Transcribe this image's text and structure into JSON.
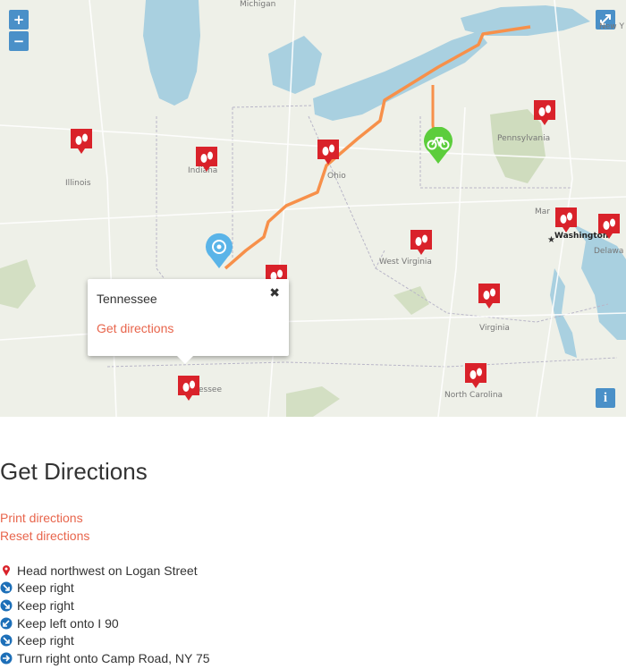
{
  "map": {
    "zoom_in": "+",
    "zoom_out": "−",
    "fullscreen_icon": "expand-icon",
    "info_icon": "i",
    "labels": {
      "michigan": "Michigan",
      "new_york": "New Y",
      "pennsylvania": "Pennsylvania",
      "illinois": "Illinois",
      "indiana": "Indiana",
      "ohio": "Ohio",
      "maryland": "Mar",
      "washington": "Washington",
      "delaware": "Delawa",
      "west_virginia": "West Virginia",
      "virginia": "Virginia",
      "tennessee": "essee",
      "north_carolina": "North Carolina"
    },
    "colors": {
      "route": "#f7904a",
      "water": "#a9d0e0",
      "marker_red": "#d9222a",
      "marker_blue": "#5ab4e8",
      "marker_green": "#5ccd3c"
    }
  },
  "popup": {
    "title": "Tennessee",
    "link": "Get directions",
    "close": "✖"
  },
  "directions": {
    "heading": "Get Directions",
    "print_link": "Print directions",
    "reset_link": "Reset directions",
    "steps": [
      {
        "icon": "pin-icon",
        "text": "Head northwest on Logan Street"
      },
      {
        "icon": "keep-right-icon",
        "text": "Keep right"
      },
      {
        "icon": "keep-right-icon",
        "text": "Keep right"
      },
      {
        "icon": "keep-left-icon",
        "text": "Keep left onto I 90"
      },
      {
        "icon": "keep-right-icon",
        "text": "Keep right"
      },
      {
        "icon": "turn-right-icon",
        "text": "Turn right onto Camp Road, NY 75"
      }
    ]
  }
}
